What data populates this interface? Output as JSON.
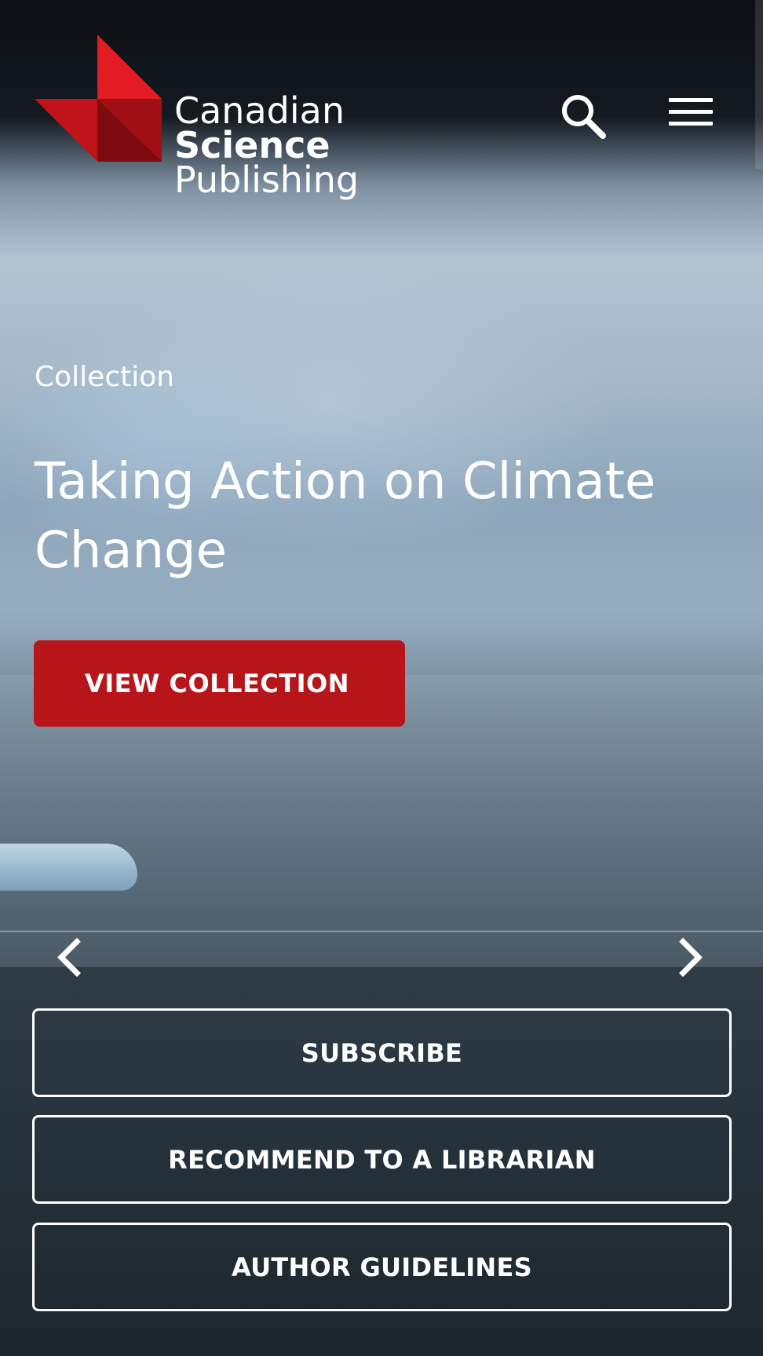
{
  "brand": {
    "line1": "Canadian",
    "line2": "Science",
    "line3": "Publishing",
    "colors": {
      "primary_red": "#e31c23",
      "dark_red": "#8b0c10",
      "accent_button": "#b8151b"
    }
  },
  "header": {
    "search_icon": "search-icon",
    "menu_icon": "hamburger-menu-icon"
  },
  "hero": {
    "eyebrow": "Collection",
    "title": "Taking Action on Climate Change",
    "cta_label": "VIEW COLLECTION",
    "prev_icon": "chevron-left-icon",
    "next_icon": "chevron-right-icon"
  },
  "actions": {
    "subscribe": "SUBSCRIBE",
    "recommend": "RECOMMEND TO A LIBRARIAN",
    "author_guidelines": "AUTHOR GUIDELINES"
  }
}
